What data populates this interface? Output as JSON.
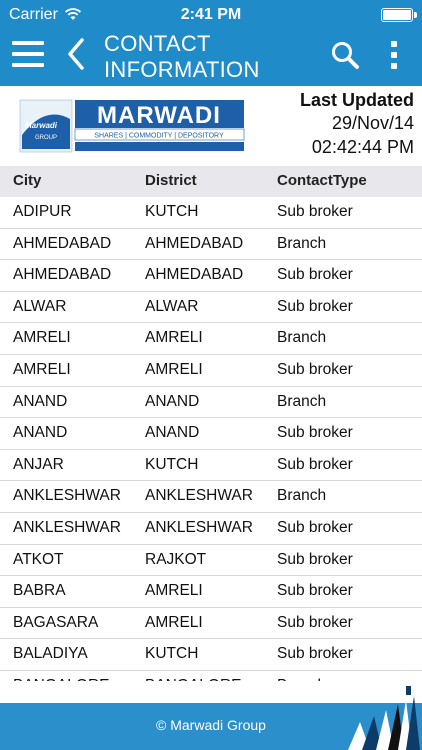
{
  "status_bar": {
    "carrier": "Carrier",
    "time": "2:41 PM"
  },
  "nav": {
    "title": "CONTACT\nINFORMATION"
  },
  "header": {
    "logo_text": "MARWADI",
    "logo_tagline": "SHARES | COMMODITY | DEPOSITORY",
    "logo_badge": "Marwadi",
    "logo_badge_sub": "GROUP",
    "last_updated_label": "Last Updated",
    "date": "29/Nov/14",
    "time": "02:42:44 PM"
  },
  "table": {
    "columns": [
      "City",
      "District",
      "ContactType"
    ],
    "rows": [
      [
        "ADIPUR",
        "KUTCH",
        "Sub broker"
      ],
      [
        "AHMEDABAD",
        "AHMEDABAD",
        "Branch"
      ],
      [
        "AHMEDABAD",
        "AHMEDABAD",
        "Sub broker"
      ],
      [
        "ALWAR",
        "ALWAR",
        "Sub broker"
      ],
      [
        "AMRELI",
        "AMRELI",
        "Branch"
      ],
      [
        "AMRELI",
        "AMRELI",
        "Sub broker"
      ],
      [
        "ANAND",
        "ANAND",
        "Branch"
      ],
      [
        "ANAND",
        "ANAND",
        "Sub broker"
      ],
      [
        "ANJAR",
        "KUTCH",
        "Sub broker"
      ],
      [
        "ANKLESHWAR",
        "ANKLESHWAR",
        "Branch"
      ],
      [
        "ANKLESHWAR",
        "ANKLESHWAR",
        "Sub broker"
      ],
      [
        "ATKOT",
        "RAJKOT",
        "Sub broker"
      ],
      [
        "BABRA",
        "AMRELI",
        "Sub broker"
      ],
      [
        "BAGASARA",
        "AMRELI",
        "Sub broker"
      ],
      [
        "BALADIYA",
        "KUTCH",
        "Sub broker"
      ],
      [
        "BANGALORE",
        "BANGALORE",
        "Branch"
      ]
    ]
  },
  "footer": {
    "copyright": "© Marwadi Group"
  },
  "colors": {
    "brand_blue": "#1f8bc9",
    "header_gray": "#e8e8ec",
    "logo_blue": "#1d5fa8"
  }
}
